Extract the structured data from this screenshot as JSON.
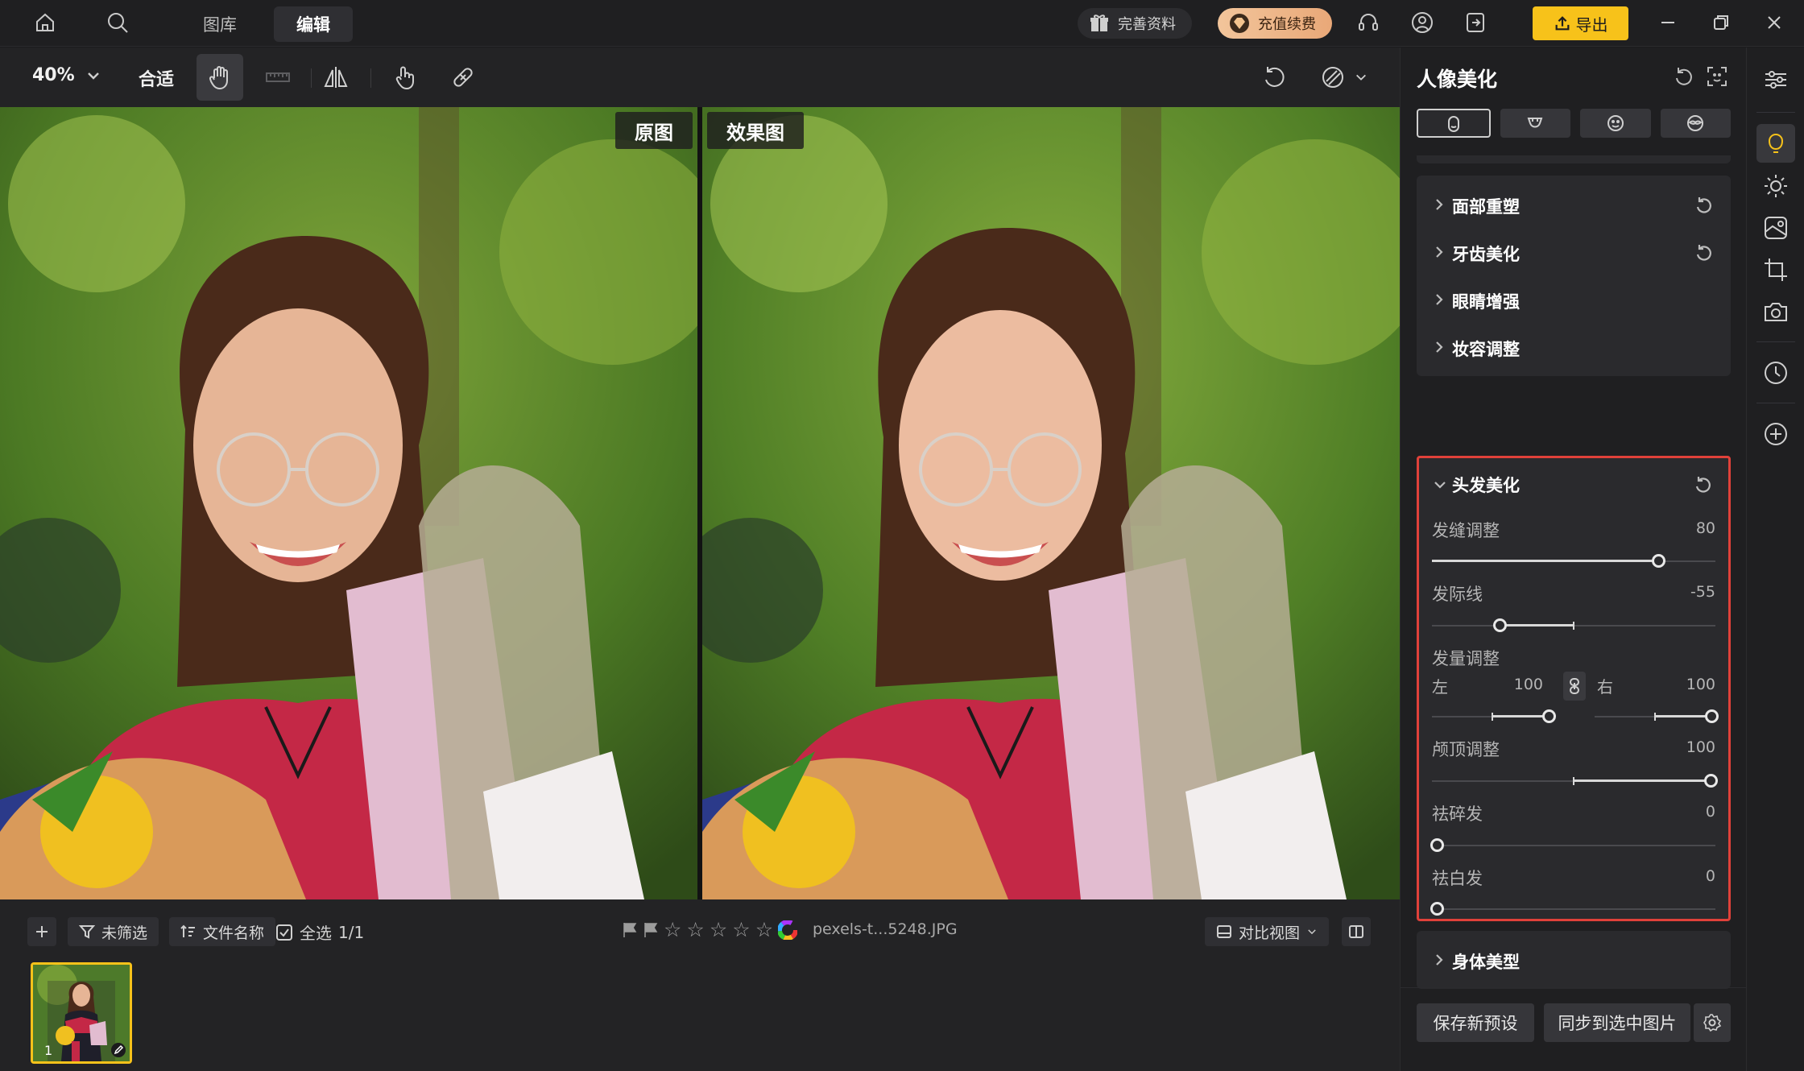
{
  "topbar": {
    "tabs": [
      {
        "label": "图库"
      },
      {
        "label": "编辑"
      }
    ],
    "gift_label": "完善资料",
    "vip_label": "充值续费",
    "export_label": "导出",
    "accent_color": "#f7c21a"
  },
  "toolbar": {
    "zoom": "40%",
    "fit_label": "合适",
    "tools": [
      "hand-icon",
      "ruler-icon",
      "flip-icon",
      "touch-icon",
      "bandage-icon"
    ]
  },
  "canvas": {
    "original_label": "原图",
    "result_label": "效果图"
  },
  "filmstrip": {
    "filter_label": "未筛选",
    "sort_label": "文件名称",
    "select_all_label": "全选",
    "count": "1/1",
    "filename": "pexels-t...5248.JPG",
    "compare_view_label": "对比视图",
    "thumb_number": "1",
    "stars": 0
  },
  "panel": {
    "title": "人像美化",
    "subtabs": [
      "face-icon",
      "body-icon",
      "smile-icon",
      "mask-icon"
    ],
    "sections": [
      {
        "label": "面部重塑"
      },
      {
        "label": "牙齿美化"
      },
      {
        "label": "眼睛增强"
      },
      {
        "label": "妆容调整"
      }
    ],
    "hair": {
      "title": "头发美化",
      "part": {
        "label": "发缝调整",
        "value": "80"
      },
      "hairline": {
        "label": "发际线",
        "value": "-55"
      },
      "volume": {
        "label": "发量调整",
        "left_label": "左",
        "left_value": "100",
        "right_label": "右",
        "right_value": "100"
      },
      "crown": {
        "label": "颅顶调整",
        "value": "100"
      },
      "flyaway": {
        "label": "祛碎发",
        "value": "0"
      },
      "gray": {
        "label": "祛白发",
        "value": "0"
      }
    },
    "body_section": {
      "label": "身体美型"
    },
    "footer": {
      "save_preset": "保存新预设",
      "sync": "同步到选中图片"
    }
  }
}
